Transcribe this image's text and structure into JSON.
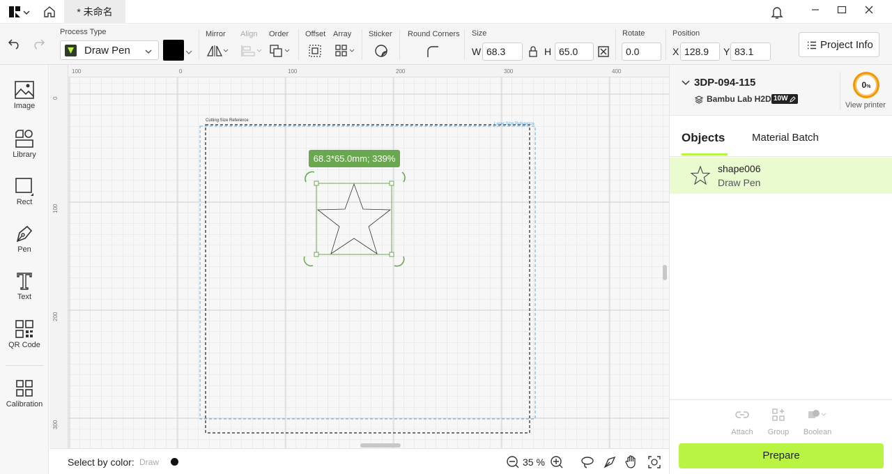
{
  "tab": {
    "title": "* 未命名"
  },
  "toolbar": {
    "process_type_label": "Process Type",
    "process_type_value": "Draw Pen",
    "mirror_label": "Mirror",
    "align_label": "Align",
    "order_label": "Order",
    "offset_label": "Offset",
    "array_label": "Array",
    "sticker_label": "Sticker",
    "round_corners_label": "Round Corners",
    "size_label": "Size",
    "w_label": "W",
    "w_value": "68.3",
    "h_label": "H",
    "h_value": "65.0",
    "rotate_label": "Rotate",
    "rotate_value": "0.0",
    "position_label": "Position",
    "x_label": "X",
    "x_value": "128.9",
    "y_label": "Y",
    "y_value": "83.1",
    "project_info_label": "Project Info",
    "color_swatch": "#000000"
  },
  "left_tools": [
    {
      "label": "Image"
    },
    {
      "label": "Library"
    },
    {
      "label": "Rect"
    },
    {
      "label": "Pen"
    },
    {
      "label": "Text"
    },
    {
      "label": "QR Code"
    },
    {
      "label": "Calibration"
    }
  ],
  "canvas": {
    "ruler_top": [
      "100",
      "0",
      "100",
      "200",
      "300",
      "400"
    ],
    "ruler_left": [
      "0",
      "100",
      "200",
      "300"
    ],
    "cutting_ref": "Cutting Size Reference",
    "laser_ref": "Laser Size Reference",
    "dimension_tooltip": "68.3*65.0mm; 339%"
  },
  "bottom": {
    "select_by_color": "Select by color:",
    "draw_label": "Draw",
    "zoom": "35 %"
  },
  "printer": {
    "name": "3DP-094-115",
    "model": "Bambu Lab H2D",
    "power_badge": "10W",
    "progress": "0",
    "progress_unit": "%",
    "view_printer": "View printer"
  },
  "panel": {
    "tabs": [
      "Objects",
      "Material Batch"
    ],
    "objects": [
      {
        "name": "shape006",
        "type": "Draw Pen"
      }
    ],
    "actions": [
      "Attach",
      "Group",
      "Boolean"
    ],
    "prepare": "Prepare"
  },
  "colors": {
    "accent": "#b9f443",
    "selection": "#6aa84f",
    "selected_row": "#ebfbd0",
    "progress_ring": "#f39800"
  }
}
